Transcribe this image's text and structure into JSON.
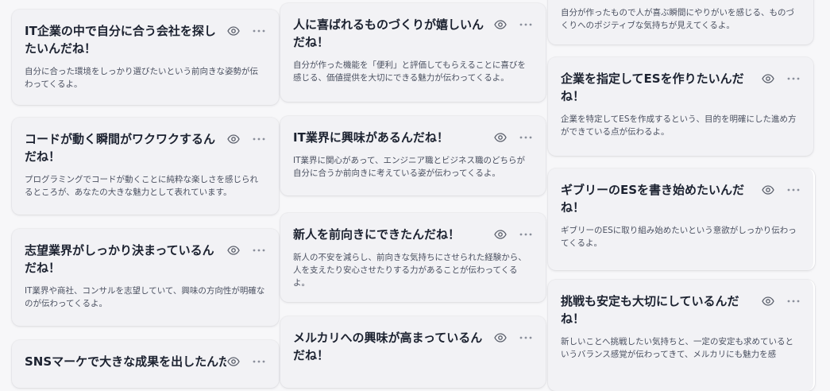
{
  "cards": [
    {
      "title": "IT企業の中で自分に合う会社を探したいんだね！",
      "desc": "自分に合った環境をしっかり選びたいという前向きな姿勢が伝わってくるよ。",
      "view_icon": "eye-icon",
      "more_icon": "more-horizontal-icon"
    },
    {
      "title": "コードが動く瞬間がワクワクするんだね！",
      "desc": "プログラミングでコードが動くことに純粋な楽しさを感じられるところが、あなたの大きな魅力として表れています。",
      "view_icon": "eye-icon",
      "more_icon": "more-horizontal-icon"
    },
    {
      "title": "志望業界がしっかり決まっているんだね！",
      "desc": "IT業界や商社、コンサルを志望していて、興味の方向性が明確なのが伝わってくるよ。",
      "view_icon": "eye-icon",
      "more_icon": "more-horizontal-icon"
    },
    {
      "title": "SNSマーケで大きな成果を出したんだね！",
      "desc": "",
      "view_icon": "eye-icon",
      "more_icon": "more-horizontal-icon"
    },
    {
      "title": "人に喜ばれるものづくりが嬉しいんだね！",
      "desc": "自分が作った機能を「便利」と評価してもらえることに喜びを感じる、価値提供を大切にできる魅力が伝わってくるよ。",
      "view_icon": "eye-icon",
      "more_icon": "more-horizontal-icon"
    },
    {
      "title": "IT業界に興味があるんだね！",
      "desc": "IT業界に関心があって、エンジニア職とビジネス職のどちらが自分に合うか前向きに考えている姿が伝わってくるよ。",
      "view_icon": "eye-icon",
      "more_icon": "more-horizontal-icon"
    },
    {
      "title": "新人を前向きにできたんだね！",
      "desc": "新人の不安を減らし、前向きな気持ちにさせられた経験から、人を支えたり安心させたりする力があることが伝わってくるよ。",
      "view_icon": "eye-icon",
      "more_icon": "more-horizontal-icon"
    },
    {
      "title": "メルカリへの興味が高まっているんだね！",
      "desc": "",
      "view_icon": "eye-icon",
      "more_icon": "more-horizontal-icon"
    },
    {
      "title": "",
      "desc": "自分が作ったもので人が喜ぶ瞬間にやりがいを感じる、ものづくりへのポジティブな気持ちが見えてくるよ。",
      "view_icon": "eye-icon",
      "more_icon": "more-horizontal-icon"
    },
    {
      "title": "企業を指定してESを作りたいんだね！",
      "desc": "企業を特定してESを作成するという、目的を明確にした進め方ができている点が伝わるよ。",
      "view_icon": "eye-icon",
      "more_icon": "more-horizontal-icon"
    },
    {
      "title": "ギブリーのESを書き始めたいんだね！",
      "desc": "ギブリーのESに取り組み始めたいという意欲がしっかり伝わってくるよ。",
      "view_icon": "eye-icon",
      "more_icon": "more-horizontal-icon"
    },
    {
      "title": "挑戦も安定も大切にしているんだね！",
      "desc": "新しいことへ挑戦したい気持ちと、一定の安定も求めているというバランス感覚が伝わってきて、メルカリにも魅力を感",
      "view_icon": "eye-icon",
      "more_icon": "more-horizontal-icon"
    }
  ],
  "colors": {
    "card_bg": "#f2f2f5",
    "title": "#1c2230",
    "desc": "#4a5060",
    "icon": "#5a5f6b"
  }
}
